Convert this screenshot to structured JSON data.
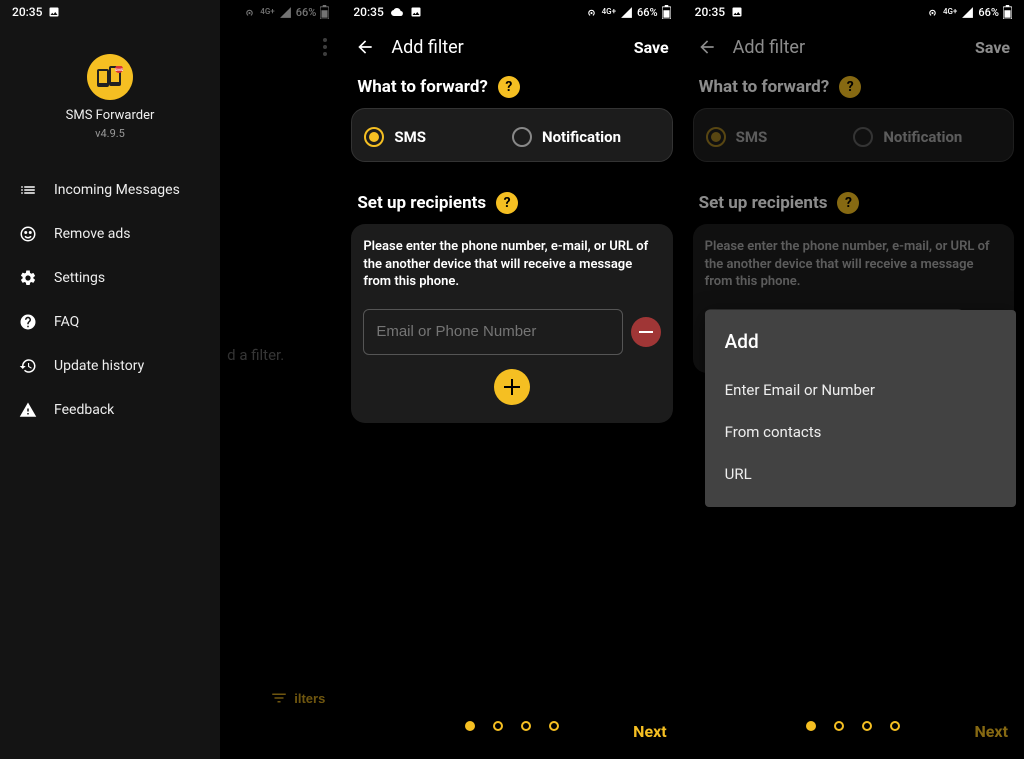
{
  "status": {
    "time": "20:35",
    "battery": "66%"
  },
  "screen1": {
    "app_name": "SMS Forwarder",
    "version": "v4.9.5",
    "menu": {
      "incoming": "Incoming Messages",
      "remove_ads": "Remove ads",
      "settings": "Settings",
      "faq": "FAQ",
      "update_history": "Update history",
      "feedback": "Feedback"
    },
    "empty_hint": "d a filter.",
    "fab_label": "ilters"
  },
  "addfilter": {
    "title": "Add filter",
    "save": "Save",
    "what_to_forward": "What to forward?",
    "sms": "SMS",
    "notification": "Notification",
    "set_up_recipients": "Set up recipients",
    "instructions": "Please enter the phone number, e-mail, or URL of the another device that will receive a message from this phone.",
    "input_placeholder": "Email or Phone Number",
    "next": "Next"
  },
  "popup": {
    "title": "Add",
    "options": {
      "email": "Enter Email or Number",
      "contacts": "From contacts",
      "url": "URL"
    }
  }
}
